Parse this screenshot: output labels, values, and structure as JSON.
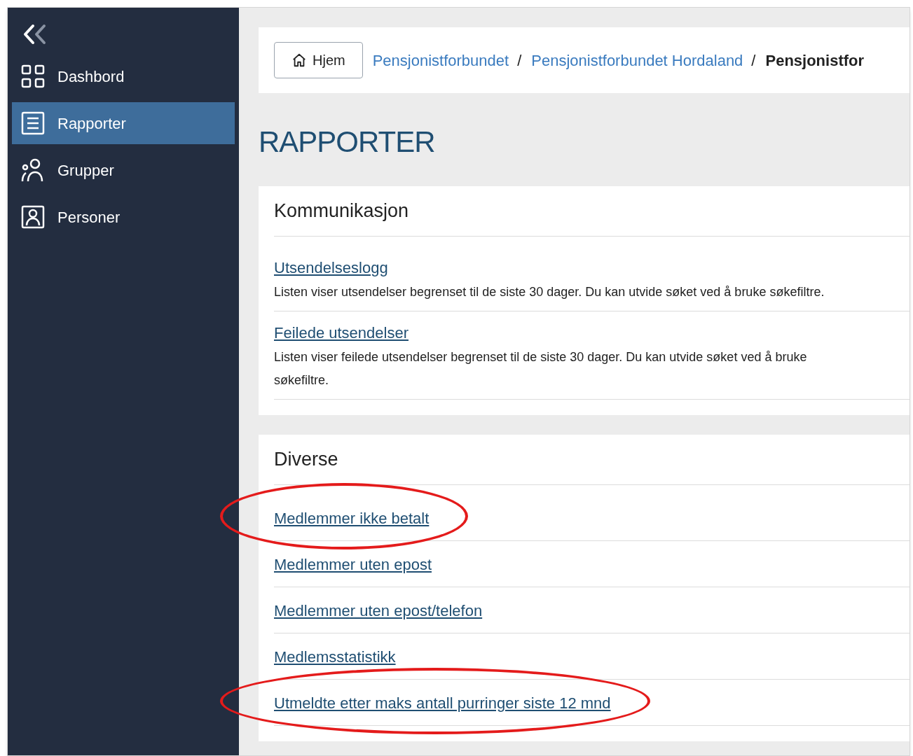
{
  "sidebar": {
    "items": [
      {
        "label": "Dashbord",
        "kind": "grid",
        "selected": false
      },
      {
        "label": "Rapporter",
        "kind": "report",
        "selected": true
      },
      {
        "label": "Grupper",
        "kind": "group",
        "selected": false
      },
      {
        "label": "Personer",
        "kind": "person",
        "selected": false
      }
    ]
  },
  "breadcrumb": {
    "home": "Hjem",
    "items": [
      {
        "label": "Pensjonistforbundet",
        "current": false
      },
      {
        "label": "Pensjonistforbundet Hordaland",
        "current": false
      },
      {
        "label": "Pensjonistfor",
        "current": true
      }
    ],
    "separator": "/"
  },
  "page_title": "RAPPORTER",
  "sections": [
    {
      "title": "Kommunikasjon",
      "links": [
        {
          "label": "Utsendelseslogg",
          "description": "Listen viser utsendelser begrenset til de siste 30 dager. Du kan utvide søket ved å bruke søkefiltre.",
          "circled": false
        },
        {
          "label": "Feilede utsendelser",
          "description": "Listen viser feilede utsendelser begrenset til de siste 30 dager. Du kan utvide søket ved å bruke søkefiltre.",
          "circled": false
        }
      ]
    },
    {
      "title": "Diverse",
      "links": [
        {
          "label": "Medlemmer ikke betalt",
          "circled": true
        },
        {
          "label": "Medlemmer uten epost",
          "circled": false
        },
        {
          "label": "Medlemmer uten epost/telefon",
          "circled": false
        },
        {
          "label": "Medlemsstatistikk",
          "circled": false
        },
        {
          "label": "Utmeldte etter maks antall purringer siste 12 mnd",
          "circled": true
        }
      ]
    }
  ]
}
